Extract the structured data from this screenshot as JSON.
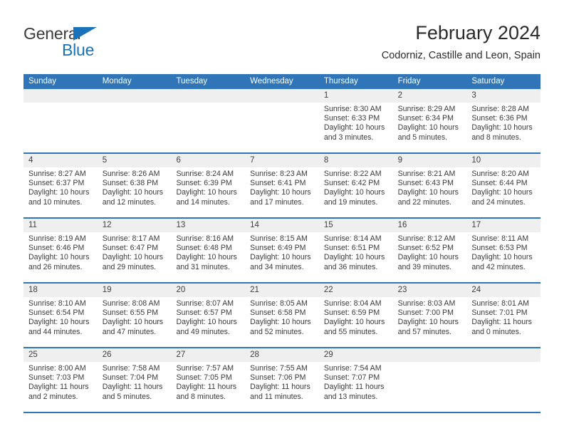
{
  "brand": {
    "name_part1": "General",
    "name_part2": "Blue",
    "triangle_color": "#1a72ba"
  },
  "header": {
    "month_title": "February 2024",
    "location": "Codorniz, Castille and Leon, Spain"
  },
  "theme": {
    "header_blue": "#3075b8",
    "daynum_band": "#efefef",
    "text": "#3a3a3a"
  },
  "calendar": {
    "weekday_headers": [
      "Sunday",
      "Monday",
      "Tuesday",
      "Wednesday",
      "Thursday",
      "Friday",
      "Saturday"
    ],
    "weeks": [
      [
        {
          "day": "",
          "lines": []
        },
        {
          "day": "",
          "lines": []
        },
        {
          "day": "",
          "lines": []
        },
        {
          "day": "",
          "lines": []
        },
        {
          "day": "1",
          "lines": [
            "Sunrise: 8:30 AM",
            "Sunset: 6:33 PM",
            "Daylight: 10 hours",
            "and 3 minutes."
          ]
        },
        {
          "day": "2",
          "lines": [
            "Sunrise: 8:29 AM",
            "Sunset: 6:34 PM",
            "Daylight: 10 hours",
            "and 5 minutes."
          ]
        },
        {
          "day": "3",
          "lines": [
            "Sunrise: 8:28 AM",
            "Sunset: 6:36 PM",
            "Daylight: 10 hours",
            "and 8 minutes."
          ]
        }
      ],
      [
        {
          "day": "4",
          "lines": [
            "Sunrise: 8:27 AM",
            "Sunset: 6:37 PM",
            "Daylight: 10 hours",
            "and 10 minutes."
          ]
        },
        {
          "day": "5",
          "lines": [
            "Sunrise: 8:26 AM",
            "Sunset: 6:38 PM",
            "Daylight: 10 hours",
            "and 12 minutes."
          ]
        },
        {
          "day": "6",
          "lines": [
            "Sunrise: 8:24 AM",
            "Sunset: 6:39 PM",
            "Daylight: 10 hours",
            "and 14 minutes."
          ]
        },
        {
          "day": "7",
          "lines": [
            "Sunrise: 8:23 AM",
            "Sunset: 6:41 PM",
            "Daylight: 10 hours",
            "and 17 minutes."
          ]
        },
        {
          "day": "8",
          "lines": [
            "Sunrise: 8:22 AM",
            "Sunset: 6:42 PM",
            "Daylight: 10 hours",
            "and 19 minutes."
          ]
        },
        {
          "day": "9",
          "lines": [
            "Sunrise: 8:21 AM",
            "Sunset: 6:43 PM",
            "Daylight: 10 hours",
            "and 22 minutes."
          ]
        },
        {
          "day": "10",
          "lines": [
            "Sunrise: 8:20 AM",
            "Sunset: 6:44 PM",
            "Daylight: 10 hours",
            "and 24 minutes."
          ]
        }
      ],
      [
        {
          "day": "11",
          "lines": [
            "Sunrise: 8:19 AM",
            "Sunset: 6:46 PM",
            "Daylight: 10 hours",
            "and 26 minutes."
          ]
        },
        {
          "day": "12",
          "lines": [
            "Sunrise: 8:17 AM",
            "Sunset: 6:47 PM",
            "Daylight: 10 hours",
            "and 29 minutes."
          ]
        },
        {
          "day": "13",
          "lines": [
            "Sunrise: 8:16 AM",
            "Sunset: 6:48 PM",
            "Daylight: 10 hours",
            "and 31 minutes."
          ]
        },
        {
          "day": "14",
          "lines": [
            "Sunrise: 8:15 AM",
            "Sunset: 6:49 PM",
            "Daylight: 10 hours",
            "and 34 minutes."
          ]
        },
        {
          "day": "15",
          "lines": [
            "Sunrise: 8:14 AM",
            "Sunset: 6:51 PM",
            "Daylight: 10 hours",
            "and 36 minutes."
          ]
        },
        {
          "day": "16",
          "lines": [
            "Sunrise: 8:12 AM",
            "Sunset: 6:52 PM",
            "Daylight: 10 hours",
            "and 39 minutes."
          ]
        },
        {
          "day": "17",
          "lines": [
            "Sunrise: 8:11 AM",
            "Sunset: 6:53 PM",
            "Daylight: 10 hours",
            "and 42 minutes."
          ]
        }
      ],
      [
        {
          "day": "18",
          "lines": [
            "Sunrise: 8:10 AM",
            "Sunset: 6:54 PM",
            "Daylight: 10 hours",
            "and 44 minutes."
          ]
        },
        {
          "day": "19",
          "lines": [
            "Sunrise: 8:08 AM",
            "Sunset: 6:55 PM",
            "Daylight: 10 hours",
            "and 47 minutes."
          ]
        },
        {
          "day": "20",
          "lines": [
            "Sunrise: 8:07 AM",
            "Sunset: 6:57 PM",
            "Daylight: 10 hours",
            "and 49 minutes."
          ]
        },
        {
          "day": "21",
          "lines": [
            "Sunrise: 8:05 AM",
            "Sunset: 6:58 PM",
            "Daylight: 10 hours",
            "and 52 minutes."
          ]
        },
        {
          "day": "22",
          "lines": [
            "Sunrise: 8:04 AM",
            "Sunset: 6:59 PM",
            "Daylight: 10 hours",
            "and 55 minutes."
          ]
        },
        {
          "day": "23",
          "lines": [
            "Sunrise: 8:03 AM",
            "Sunset: 7:00 PM",
            "Daylight: 10 hours",
            "and 57 minutes."
          ]
        },
        {
          "day": "24",
          "lines": [
            "Sunrise: 8:01 AM",
            "Sunset: 7:01 PM",
            "Daylight: 11 hours",
            "and 0 minutes."
          ]
        }
      ],
      [
        {
          "day": "25",
          "lines": [
            "Sunrise: 8:00 AM",
            "Sunset: 7:03 PM",
            "Daylight: 11 hours",
            "and 2 minutes."
          ]
        },
        {
          "day": "26",
          "lines": [
            "Sunrise: 7:58 AM",
            "Sunset: 7:04 PM",
            "Daylight: 11 hours",
            "and 5 minutes."
          ]
        },
        {
          "day": "27",
          "lines": [
            "Sunrise: 7:57 AM",
            "Sunset: 7:05 PM",
            "Daylight: 11 hours",
            "and 8 minutes."
          ]
        },
        {
          "day": "28",
          "lines": [
            "Sunrise: 7:55 AM",
            "Sunset: 7:06 PM",
            "Daylight: 11 hours",
            "and 11 minutes."
          ]
        },
        {
          "day": "29",
          "lines": [
            "Sunrise: 7:54 AM",
            "Sunset: 7:07 PM",
            "Daylight: 11 hours",
            "and 13 minutes."
          ]
        },
        {
          "day": "",
          "lines": []
        },
        {
          "day": "",
          "lines": []
        }
      ]
    ]
  }
}
